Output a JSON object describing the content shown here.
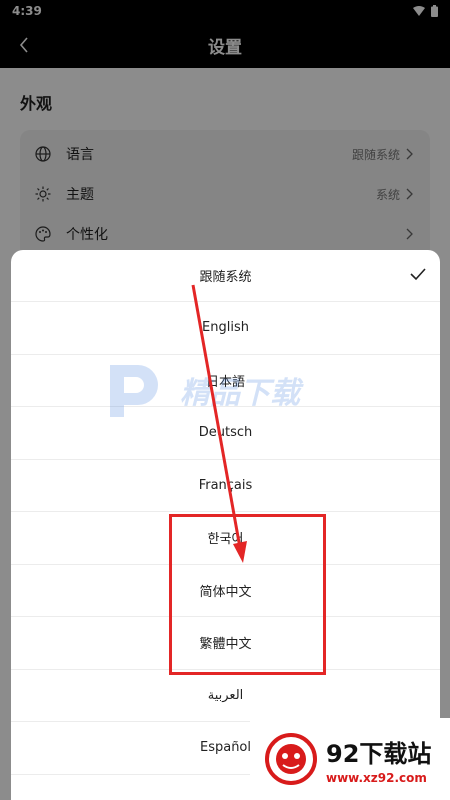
{
  "status": {
    "time": "4:39"
  },
  "appbar": {
    "title": "设置"
  },
  "appearance": {
    "section_title": "外观",
    "rows": [
      {
        "label": "语言",
        "value": "跟随系统"
      },
      {
        "label": "主题",
        "value": "系统"
      },
      {
        "label": "个性化",
        "value": ""
      }
    ]
  },
  "language_sheet": {
    "options": [
      "跟随系统",
      "English",
      "日本語",
      "Deutsch",
      "Français",
      "한국어",
      "简体中文",
      "繁體中文",
      "العربية",
      "Español"
    ],
    "selected": "跟随系统"
  },
  "watermark": {
    "text": "精品下载"
  },
  "badge": {
    "title": "92下载站",
    "url": "www.xz92.com"
  },
  "colors": {
    "annotation": "#e32626",
    "scrim": "rgba(0,0,0,0.45)"
  }
}
